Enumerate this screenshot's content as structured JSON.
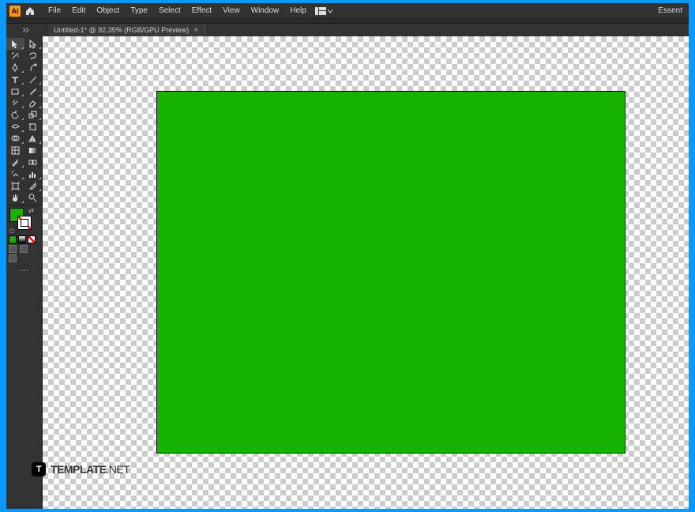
{
  "app": {
    "logo_text": "Ai",
    "right_label": "Essent"
  },
  "menus": {
    "file": "File",
    "edit": "Edit",
    "object": "Object",
    "type": "Type",
    "select": "Select",
    "effect": "Effect",
    "view": "View",
    "window": "Window",
    "help": "Help"
  },
  "tab": {
    "title": "Untitled-1* @ 92.35% (RGB/GPU Preview)",
    "close": "×"
  },
  "tools": {
    "selection": "selection",
    "direct_selection": "direct-selection",
    "magic_wand": "magic-wand",
    "lasso": "lasso",
    "pen": "pen",
    "curvature": "curvature",
    "type": "type",
    "line": "line",
    "rectangle": "rectangle",
    "paintbrush": "paintbrush",
    "shaper": "shaper",
    "eraser": "eraser",
    "rotate": "rotate",
    "scale": "scale",
    "width": "width",
    "warp": "warp",
    "free_transform": "free-transform",
    "shape_builder": "shape-builder",
    "perspective": "perspective",
    "mesh": "mesh",
    "gradient": "gradient",
    "eyedropper": "eyedropper",
    "blend": "blend",
    "symbol_sprayer": "symbol-sprayer",
    "column_graph": "column-graph",
    "artboard": "artboard",
    "slice": "slice",
    "hand": "hand",
    "zoom": "zoom"
  },
  "colors": {
    "fill": "#14b400",
    "stroke": "#ffffff",
    "green_rect": "#14b400"
  },
  "watermark": {
    "logo": "T",
    "text_bold": "TEMPLATE",
    "text_light": ".NET"
  }
}
